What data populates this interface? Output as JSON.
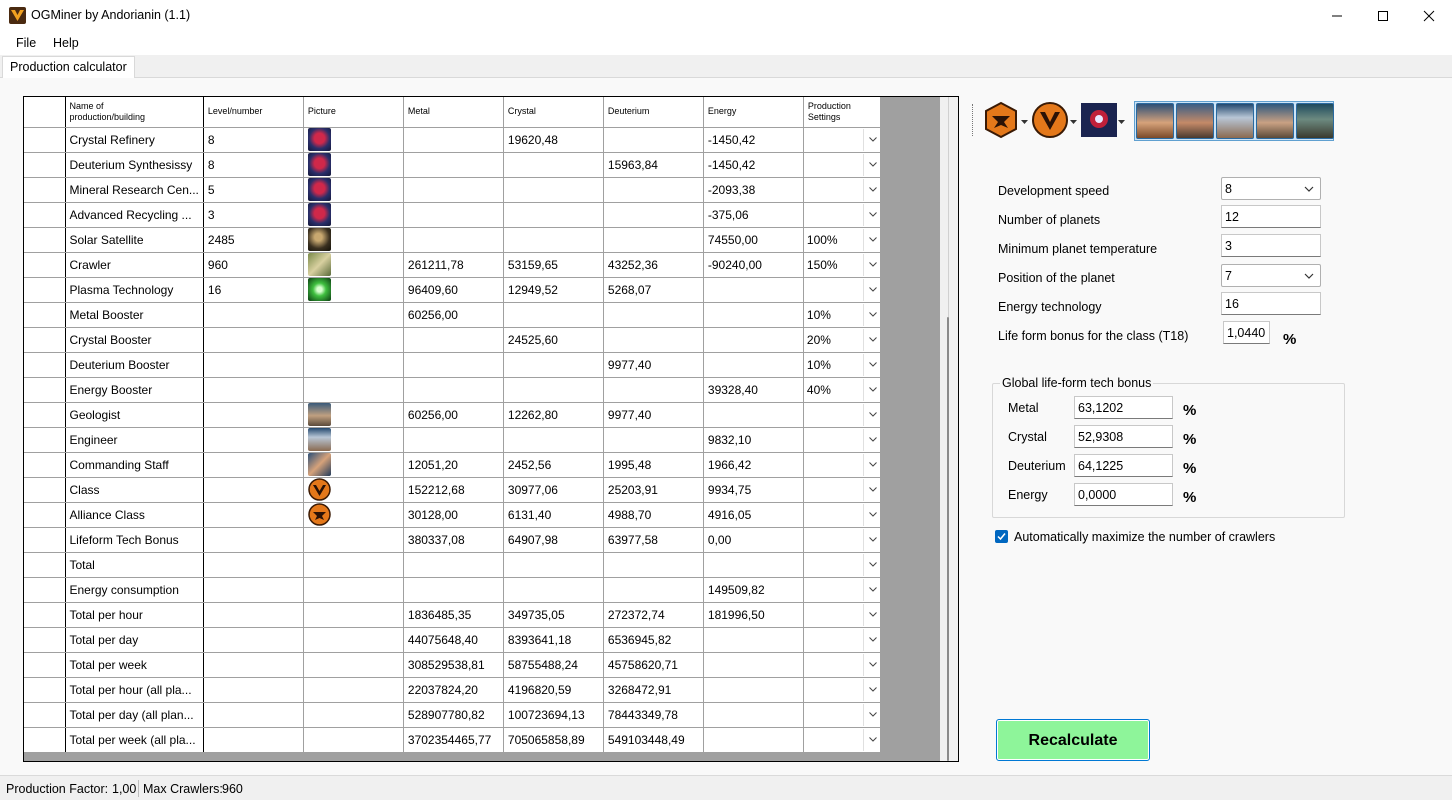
{
  "window": {
    "title": "OGMiner by Andorianin (1.1)"
  },
  "menu": {
    "file": "File",
    "help": "Help"
  },
  "tabs": [
    {
      "label": "Production calculator"
    }
  ],
  "grid": {
    "columns": {
      "name": [
        "Name of",
        "production/building"
      ],
      "level": "Level/number",
      "picture": "Picture",
      "metal": "Metal",
      "crystal": "Crystal",
      "deuterium": "Deuterium",
      "energy": "Energy",
      "settings": [
        "Production",
        "Settings"
      ]
    },
    "rows": [
      {
        "name": "Crystal Refinery",
        "level": "8",
        "pic": "lifeform-building-icon",
        "metal": "",
        "crystal": "19620,48",
        "deuterium": "",
        "energy": "-1450,42",
        "setting": ""
      },
      {
        "name": "Deuterium Synthesissy",
        "level": "8",
        "pic": "lifeform-building-icon",
        "metal": "",
        "crystal": "",
        "deuterium": "15963,84",
        "energy": "-1450,42",
        "setting": ""
      },
      {
        "name": "Mineral Research Cen...",
        "level": "5",
        "pic": "lifeform-building-icon",
        "metal": "",
        "crystal": "",
        "deuterium": "",
        "energy": "-2093,38",
        "setting": ""
      },
      {
        "name": "Advanced Recycling ...",
        "level": "3",
        "pic": "lifeform-building-icon",
        "metal": "",
        "crystal": "",
        "deuterium": "",
        "energy": "-375,06",
        "setting": ""
      },
      {
        "name": "Solar Satellite",
        "level": "2485",
        "pic": "solar-satellite-icon",
        "metal": "",
        "crystal": "",
        "deuterium": "",
        "energy": "74550,00",
        "setting": "100%"
      },
      {
        "name": "Crawler",
        "level": "960",
        "pic": "crawler-icon",
        "metal": "261211,78",
        "crystal": "53159,65",
        "deuterium": "43252,36",
        "energy": "-90240,00",
        "setting": "150%"
      },
      {
        "name": "Plasma Technology",
        "level": "16",
        "pic": "plasma-technology-icon",
        "metal": "96409,60",
        "crystal": "12949,52",
        "deuterium": "5268,07",
        "energy": "",
        "setting": ""
      },
      {
        "name": "Metal Booster",
        "level": "",
        "pic": "",
        "metal": "60256,00",
        "crystal": "",
        "deuterium": "",
        "energy": "",
        "setting": "10%"
      },
      {
        "name": "Crystal Booster",
        "level": "",
        "pic": "",
        "metal": "",
        "crystal": "24525,60",
        "deuterium": "",
        "energy": "",
        "setting": "20%"
      },
      {
        "name": "Deuterium Booster",
        "level": "",
        "pic": "",
        "metal": "",
        "crystal": "",
        "deuterium": "9977,40",
        "energy": "",
        "setting": "10%"
      },
      {
        "name": "Energy Booster",
        "level": "",
        "pic": "",
        "metal": "",
        "crystal": "",
        "deuterium": "",
        "energy": "39328,40",
        "setting": "40%"
      },
      {
        "name": "Geologist",
        "level": "",
        "pic": "geologist-icon",
        "metal": "60256,00",
        "crystal": "12262,80",
        "deuterium": "9977,40",
        "energy": "",
        "setting": ""
      },
      {
        "name": "Engineer",
        "level": "",
        "pic": "engineer-icon",
        "metal": "",
        "crystal": "",
        "deuterium": "",
        "energy": "9832,10",
        "setting": ""
      },
      {
        "name": "Commanding Staff",
        "level": "",
        "pic": "commanding-staff-icon",
        "metal": "12051,20",
        "crystal": "2452,56",
        "deuterium": "1995,48",
        "energy": "1966,42",
        "setting": ""
      },
      {
        "name": "Class",
        "level": "",
        "pic": "class-icon",
        "metal": "152212,68",
        "crystal": "30977,06",
        "deuterium": "25203,91",
        "energy": "9934,75",
        "setting": ""
      },
      {
        "name": "Alliance Class",
        "level": "",
        "pic": "alliance-class-icon",
        "metal": "30128,00",
        "crystal": "6131,40",
        "deuterium": "4988,70",
        "energy": "4916,05",
        "setting": ""
      },
      {
        "name": "Lifeform Tech Bonus",
        "level": "",
        "pic": "",
        "metal": "380337,08",
        "crystal": "64907,98",
        "deuterium": "63977,58",
        "energy": "0,00",
        "setting": ""
      },
      {
        "name": "Total",
        "level": "",
        "pic": "",
        "metal": "",
        "crystal": "",
        "deuterium": "",
        "energy": "",
        "setting": ""
      },
      {
        "name": "Energy consumption",
        "level": "",
        "pic": "",
        "metal": "",
        "crystal": "",
        "deuterium": "",
        "energy": "149509,82",
        "setting": ""
      },
      {
        "name": "Total per hour",
        "level": "",
        "pic": "",
        "metal": "1836485,35",
        "crystal": "349735,05",
        "deuterium": "272372,74",
        "energy": "181996,50",
        "setting": ""
      },
      {
        "name": "Total per day",
        "level": "",
        "pic": "",
        "metal": "44075648,40",
        "crystal": "8393641,18",
        "deuterium": "6536945,82",
        "energy": "",
        "setting": ""
      },
      {
        "name": "Total per week",
        "level": "",
        "pic": "",
        "metal": "308529538,81",
        "crystal": "58755488,24",
        "deuterium": "45758620,71",
        "energy": "",
        "setting": ""
      },
      {
        "name": "Total per hour (all pla...",
        "level": "",
        "pic": "",
        "metal": "22037824,20",
        "crystal": "4196820,59",
        "deuterium": "3268472,91",
        "energy": "",
        "setting": ""
      },
      {
        "name": "Total per day (all plan...",
        "level": "",
        "pic": "",
        "metal": "528907780,82",
        "crystal": "100723694,13",
        "deuterium": "78443349,78",
        "energy": "",
        "setting": ""
      },
      {
        "name": "Total per week (all pla...",
        "level": "",
        "pic": "",
        "metal": "3702354465,77",
        "crystal": "705065858,89",
        "deuterium": "549103448,49",
        "energy": "",
        "setting": ""
      }
    ]
  },
  "toolbar": {
    "class_buttons": [
      "alliance-class-icon",
      "player-class-icon",
      "lifeform-icon"
    ],
    "officers": [
      "commander-icon",
      "admiral-icon",
      "engineer-icon",
      "geologist-icon",
      "technocrat-icon"
    ]
  },
  "settings": {
    "development_speed": {
      "label": "Development speed",
      "value": "8"
    },
    "number_of_planets": {
      "label": "Number of planets",
      "value": "12"
    },
    "min_planet_temp": {
      "label": "Minimum planet temperature",
      "value": "3"
    },
    "planet_position": {
      "label": "Position of the planet",
      "value": "7"
    },
    "energy_technology": {
      "label": "Energy technology",
      "value": "16"
    },
    "lifeform_class_bonus": {
      "label": "Life form bonus for the class (T18)",
      "value": "1,0440",
      "unit": "%"
    }
  },
  "global_bonus": {
    "title": "Global life-form tech bonus",
    "unit": "%",
    "items": [
      {
        "label": "Metal",
        "value": "63,1202"
      },
      {
        "label": "Crystal",
        "value": "52,9308"
      },
      {
        "label": "Deuterium",
        "value": "64,1225"
      },
      {
        "label": "Energy",
        "value": "0,0000"
      }
    ]
  },
  "auto_crawlers": {
    "label": "Automatically maximize the number of crawlers",
    "checked": true
  },
  "recalculate": "Recalculate",
  "status": {
    "production_factor_label": "Production Factor:",
    "production_factor_value": "1,00",
    "max_crawlers_label": "Max Crawlers:",
    "max_crawlers_value": "960"
  },
  "colors": {
    "accent": "#0067c0",
    "recalc_bg": "#8ef59a"
  }
}
